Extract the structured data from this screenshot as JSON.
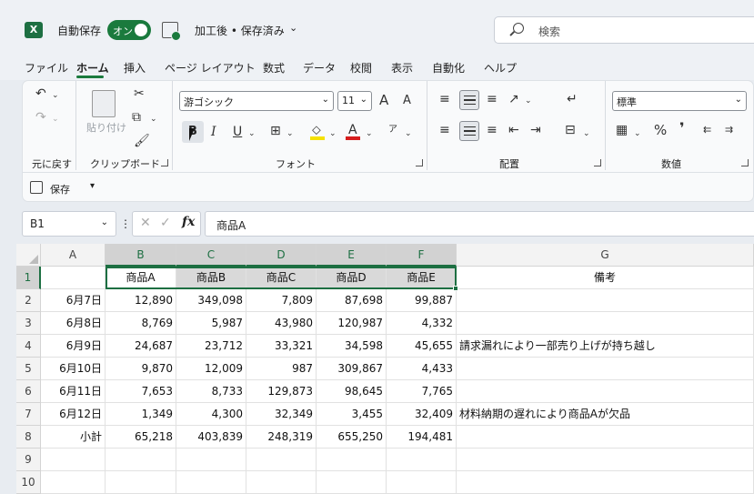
{
  "titlebar": {
    "autosave_label": "自動保存",
    "toggle_label": "オン",
    "doc_title": "加工後 • 保存済み",
    "search_placeholder": "検索"
  },
  "tabs": [
    "ファイル",
    "ホーム",
    "挿入",
    "ページ レイアウト",
    "数式",
    "データ",
    "校閲",
    "表示",
    "自動化",
    "ヘルプ"
  ],
  "active_tab": "ホーム",
  "ribbon": {
    "groups": {
      "undo": "元に戻す",
      "clipboard": "クリップボード",
      "font": "フォント",
      "alignment": "配置",
      "number": "数値"
    },
    "paste_label": "貼り付け",
    "font_name": "游ゴシック",
    "font_size": "11",
    "number_format": "標準",
    "quick_save": "保存",
    "buttons": {
      "bold": "B",
      "italic": "I",
      "underline": "U",
      "percent": "%",
      "comma": "❜",
      "font_color": "A",
      "grow": "A",
      "shrink": "A"
    }
  },
  "formula_bar": {
    "namebox": "B1",
    "formula": "商品A",
    "fx": "fx"
  },
  "grid": {
    "columns": [
      "A",
      "B",
      "C",
      "D",
      "E",
      "F",
      "G"
    ],
    "rows": [
      {
        "num": "1",
        "cells": [
          "",
          "商品A",
          "商品B",
          "商品C",
          "商品D",
          "商品E",
          "備考"
        ]
      },
      {
        "num": "2",
        "cells": [
          "6月7日",
          "12,890",
          "349,098",
          "7,809",
          "87,698",
          "99,887",
          ""
        ]
      },
      {
        "num": "3",
        "cells": [
          "6月8日",
          "8,769",
          "5,987",
          "43,980",
          "120,987",
          "4,332",
          ""
        ]
      },
      {
        "num": "4",
        "cells": [
          "6月9日",
          "24,687",
          "23,712",
          "33,321",
          "34,598",
          "45,655",
          "請求漏れにより一部売り上げが持ち越し"
        ]
      },
      {
        "num": "5",
        "cells": [
          "6月10日",
          "9,870",
          "12,009",
          "987",
          "309,867",
          "4,433",
          ""
        ]
      },
      {
        "num": "6",
        "cells": [
          "6月11日",
          "7,653",
          "8,733",
          "129,873",
          "98,645",
          "7,765",
          ""
        ]
      },
      {
        "num": "7",
        "cells": [
          "6月12日",
          "1,349",
          "4,300",
          "32,349",
          "3,455",
          "32,409",
          "材料納期の遅れにより商品Aが欠品"
        ]
      },
      {
        "num": "8",
        "cells": [
          "小計",
          "65,218",
          "403,839",
          "248,319",
          "655,250",
          "194,481",
          ""
        ]
      },
      {
        "num": "9",
        "cells": [
          "",
          "",
          "",
          "",
          "",
          "",
          ""
        ]
      },
      {
        "num": "10",
        "cells": [
          "",
          "",
          "",
          "",
          "",
          "",
          ""
        ]
      }
    ]
  }
}
